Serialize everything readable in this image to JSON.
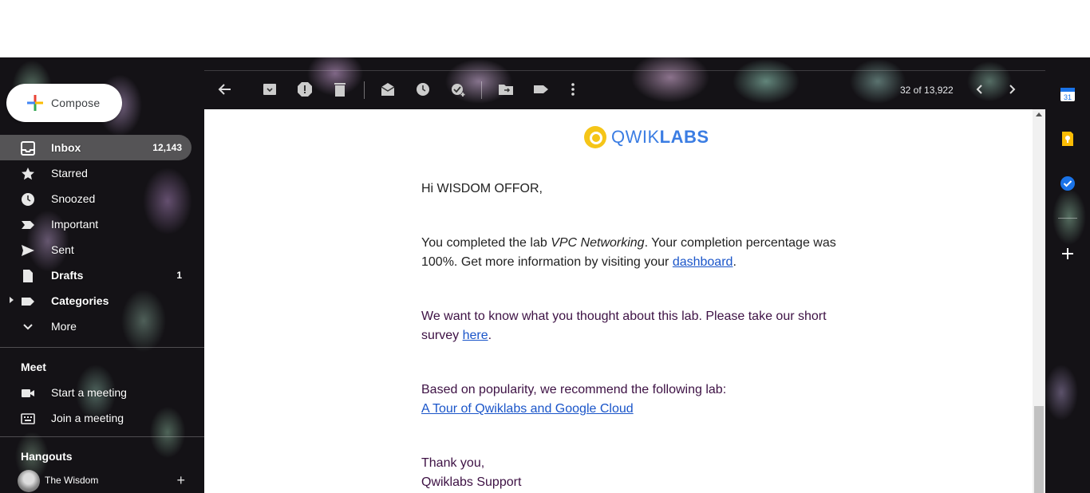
{
  "sidebar": {
    "compose_label": "Compose",
    "items": [
      {
        "label": "Inbox",
        "count": "12,143",
        "icon": "inbox-icon"
      },
      {
        "label": "Starred",
        "count": "",
        "icon": "star-icon"
      },
      {
        "label": "Snoozed",
        "count": "",
        "icon": "clock-icon"
      },
      {
        "label": "Important",
        "count": "",
        "icon": "important-icon"
      },
      {
        "label": "Sent",
        "count": "",
        "icon": "send-icon"
      },
      {
        "label": "Drafts",
        "count": "1",
        "icon": "draft-icon"
      },
      {
        "label": "Categories",
        "count": "",
        "icon": "label-icon"
      },
      {
        "label": "More",
        "count": "",
        "icon": "chevron-down-icon"
      }
    ],
    "meet": {
      "title": "Meet",
      "start": "Start a meeting",
      "join": "Join a meeting"
    },
    "hangouts": {
      "title": "Hangouts",
      "user": "The Wisdom"
    }
  },
  "toolbar": {
    "pager": "32 of 13,922"
  },
  "email": {
    "logo_part1": "QWIK",
    "logo_part2": "LABS",
    "greeting": "Hi WISDOM OFFOR,",
    "p1_a": "You completed the lab ",
    "p1_lab": "VPC Networking",
    "p1_b": ". Your completion percentage was 100%. Get more information by visiting your ",
    "p1_link": "dashboard",
    "p1_c": ".",
    "p2_a": "We want to know what you thought about this lab. Please take our short survey ",
    "p2_link": "here",
    "p2_b": ".",
    "p3_a": "Based on popularity, we recommend the following lab:",
    "p3_link": "A Tour of Qwiklabs and Google Cloud",
    "sign1": "Thank you,",
    "sign2": "Qwiklabs Support"
  },
  "rail": {
    "calendar_day": "31"
  },
  "colors": {
    "link": "#1a55c9",
    "qwiklabs_blue": "#3b7de3",
    "qwiklabs_yellow": "#f5c518"
  }
}
